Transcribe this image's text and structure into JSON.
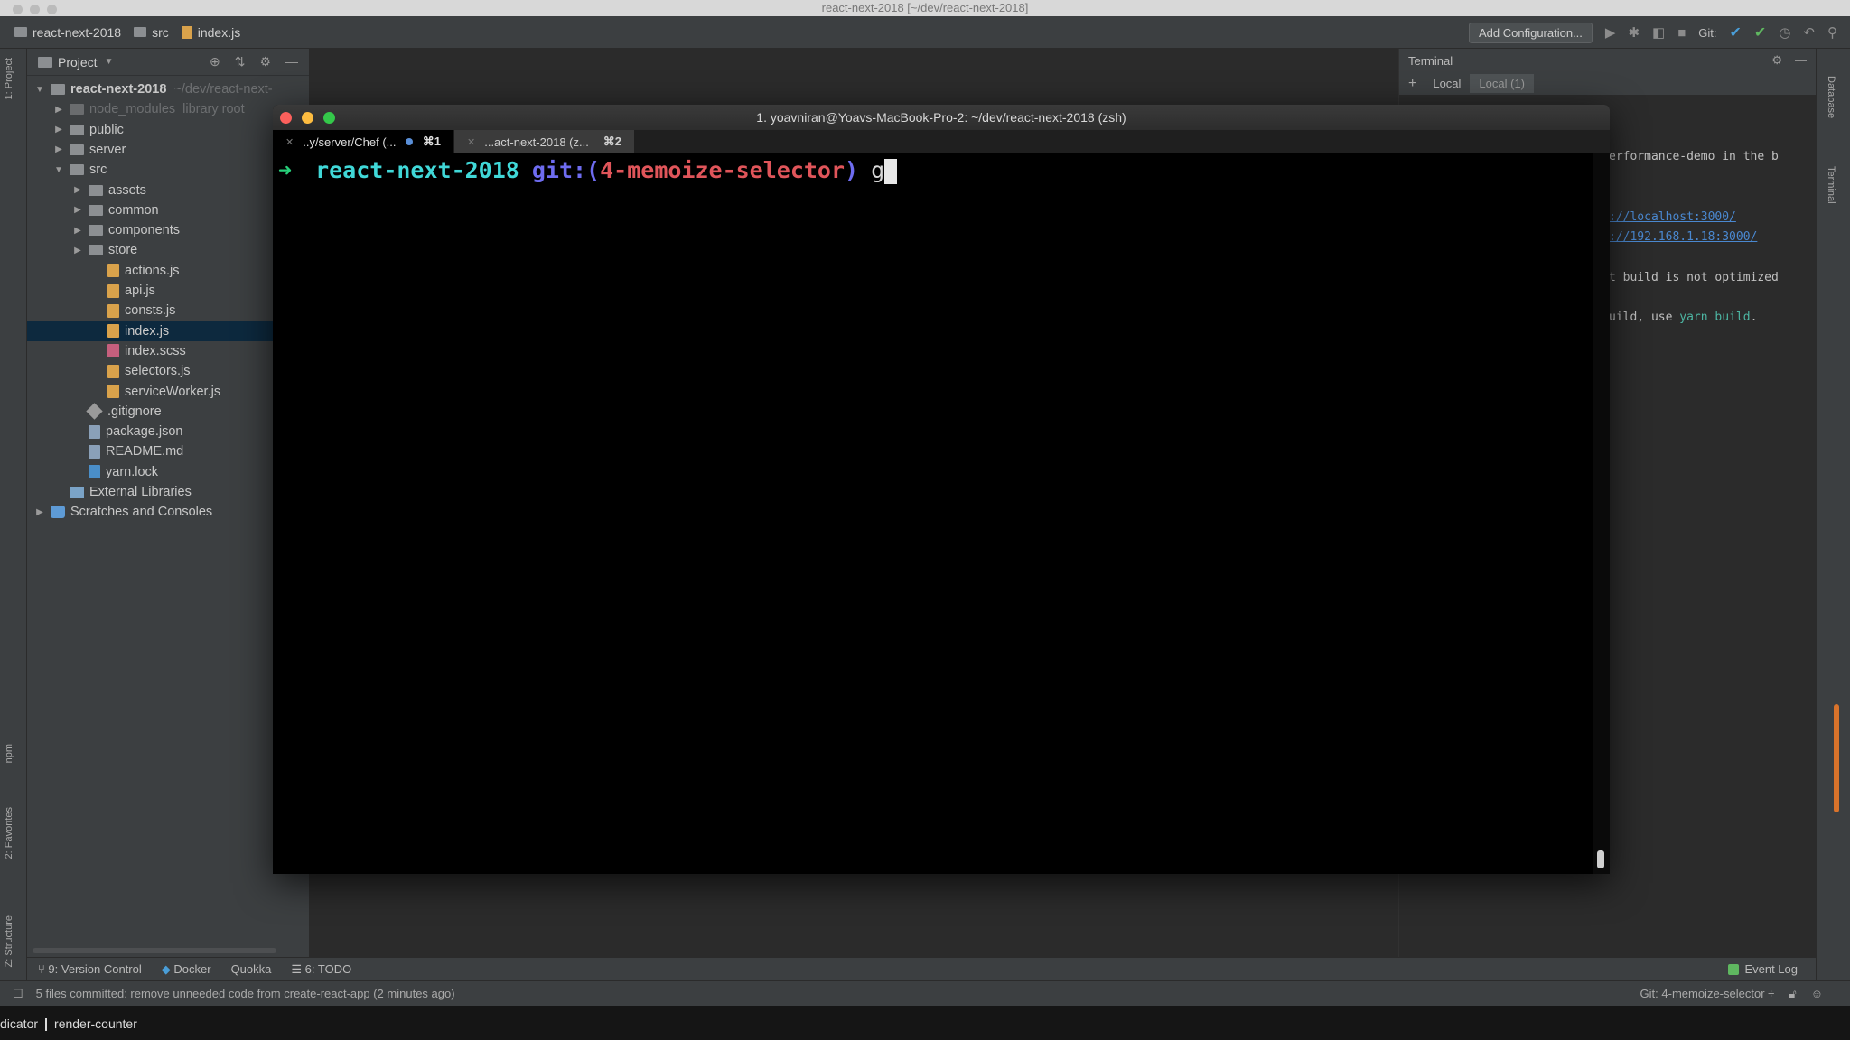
{
  "mac": {
    "title": "react-next-2018 [~/dev/react-next-2018]"
  },
  "navbar": {
    "crumbs": [
      "react-next-2018",
      "src",
      "index.js"
    ],
    "add_config": "Add Configuration...",
    "git_label": "Git:"
  },
  "project": {
    "header": "Project",
    "tree": [
      {
        "label": "react-next-2018",
        "suffix": "~/dev/react-next-",
        "indent": 0,
        "arrow": "▼",
        "icon": "folder",
        "bold": true
      },
      {
        "label": "node_modules",
        "suffix": "library root",
        "indent": 1,
        "arrow": "▶",
        "icon": "folder-dim",
        "dim": true
      },
      {
        "label": "public",
        "indent": 1,
        "arrow": "▶",
        "icon": "folder"
      },
      {
        "label": "server",
        "indent": 1,
        "arrow": "▶",
        "icon": "folder"
      },
      {
        "label": "src",
        "indent": 1,
        "arrow": "▼",
        "icon": "folder"
      },
      {
        "label": "assets",
        "indent": 2,
        "arrow": "▶",
        "icon": "folder"
      },
      {
        "label": "common",
        "indent": 2,
        "arrow": "▶",
        "icon": "folder"
      },
      {
        "label": "components",
        "indent": 2,
        "arrow": "▶",
        "icon": "folder"
      },
      {
        "label": "store",
        "indent": 2,
        "arrow": "▶",
        "icon": "folder"
      },
      {
        "label": "actions.js",
        "indent": 3,
        "icon": "js"
      },
      {
        "label": "api.js",
        "indent": 3,
        "icon": "js"
      },
      {
        "label": "consts.js",
        "indent": 3,
        "icon": "js"
      },
      {
        "label": "index.js",
        "indent": 3,
        "icon": "js",
        "selected": true
      },
      {
        "label": "index.scss",
        "indent": 3,
        "icon": "scss"
      },
      {
        "label": "selectors.js",
        "indent": 3,
        "icon": "js"
      },
      {
        "label": "serviceWorker.js",
        "indent": 3,
        "icon": "js"
      },
      {
        "label": ".gitignore",
        "indent": 2,
        "icon": "git"
      },
      {
        "label": "package.json",
        "indent": 2,
        "icon": "file"
      },
      {
        "label": "README.md",
        "indent": 2,
        "icon": "file"
      },
      {
        "label": "yarn.lock",
        "indent": 2,
        "icon": "yarn"
      },
      {
        "label": "External Libraries",
        "indent": 1,
        "icon": "lib"
      },
      {
        "label": "Scratches and Consoles",
        "indent": 0,
        "arrow": "▶",
        "icon": "scratch"
      }
    ]
  },
  "side_terminal": {
    "title": "Terminal",
    "tabs": [
      "Local",
      "Local (1)"
    ],
    "lines": [
      {
        "text": "erformance-demo in the b"
      },
      {
        "link": "://localhost:3000/"
      },
      {
        "link": "://192.168.1.18:3000/"
      },
      {
        "text": "t build is not optimized"
      },
      {
        "pre": "uild, use ",
        "green": "yarn build",
        "post": "."
      }
    ]
  },
  "iterm": {
    "title": "1. yoavniran@Yoavs-MacBook-Pro-2: ~/dev/react-next-2018 (zsh)",
    "tabs": [
      {
        "label": "..y/server/Chef (...",
        "shortcut": "⌘1"
      },
      {
        "label": "...act-next-2018 (z...",
        "shortcut": "⌘2"
      }
    ],
    "prompt": {
      "arrow": "➜",
      "dir": "react-next-2018",
      "git_word": "git:(",
      "branch": "4-memoize-selector",
      "close": ")",
      "typed": "g"
    }
  },
  "left_strip": {
    "project_label": "1: Project",
    "npm_label": "npm",
    "favorites_label": "2: Favorites",
    "structure_label": "Z: Structure"
  },
  "right_strip": {
    "db_label": "Database",
    "terminal_label": "Terminal"
  },
  "bottom_tools": {
    "vcs": "9: Version Control",
    "docker": "Docker",
    "quokka": "Quokka",
    "todo": "6: TODO",
    "event_log": "Event Log"
  },
  "status": {
    "message": "5 files committed: remove unneeded code from create-react-app (2 minutes ago)",
    "git": "Git: 4-memoize-selector ÷"
  },
  "behind": {
    "left": "dicator",
    "right": "render-counter"
  }
}
